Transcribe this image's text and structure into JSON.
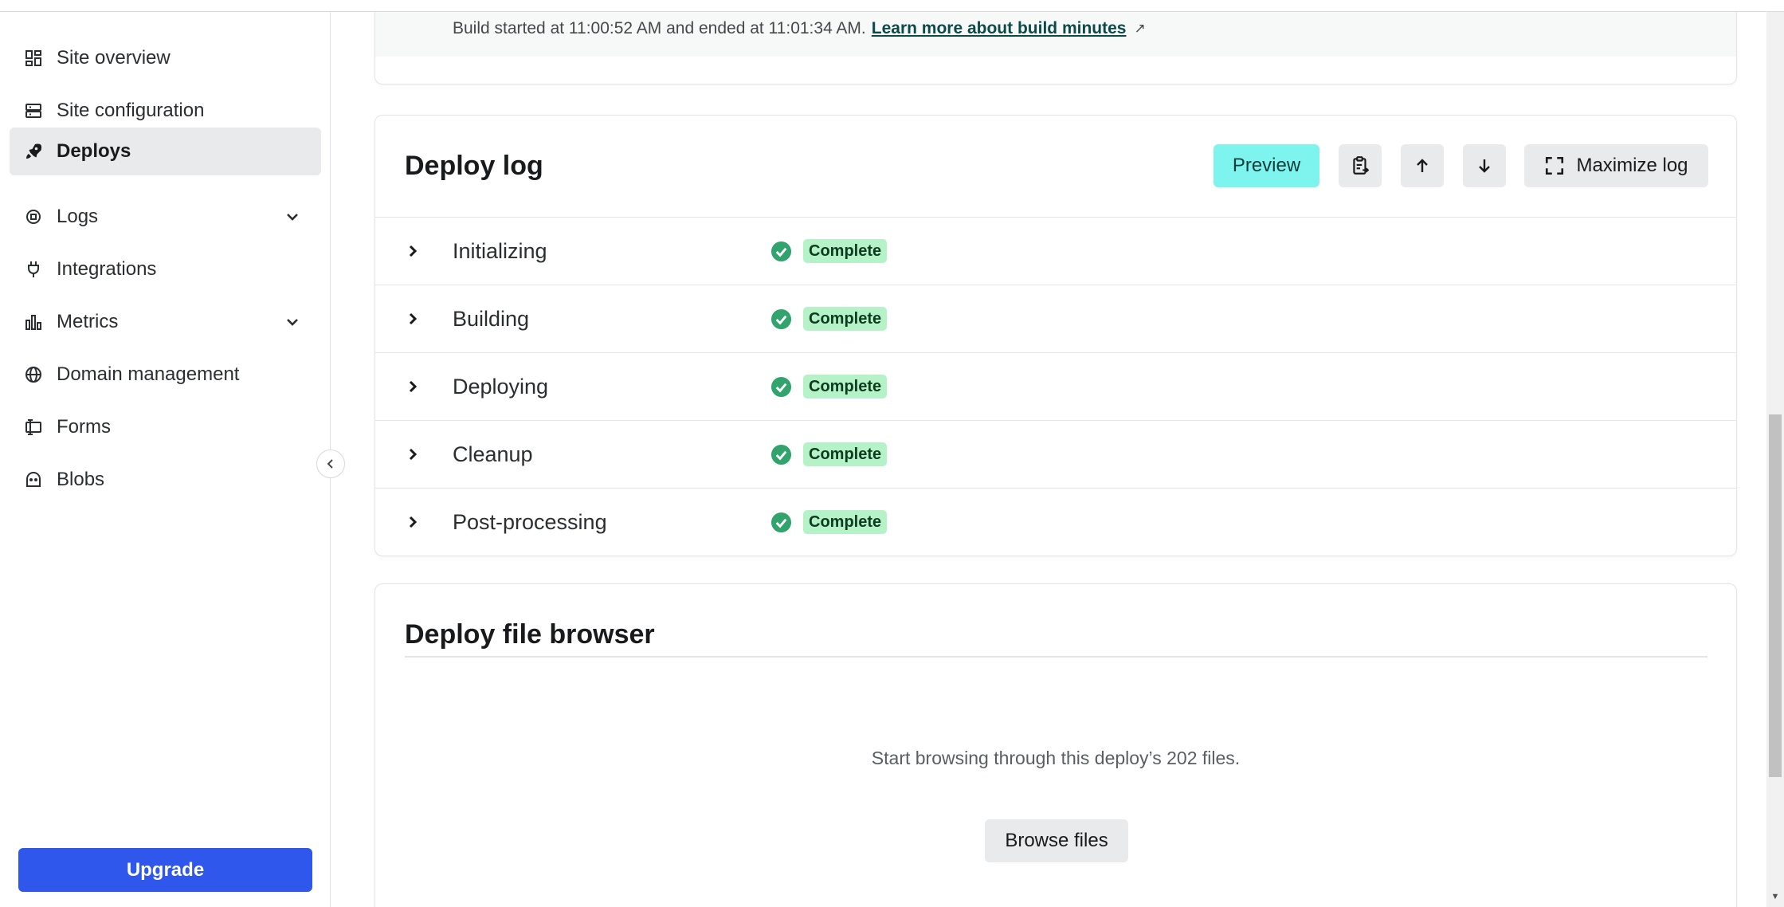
{
  "sidebar": {
    "items": [
      {
        "label": "Site overview",
        "icon": "grid-icon"
      },
      {
        "label": "Site configuration",
        "icon": "config-icon"
      },
      {
        "label": "Deploys",
        "icon": "rocket-icon",
        "active": true
      },
      {
        "label": "Logs",
        "icon": "logs-icon",
        "expandable": true
      },
      {
        "label": "Integrations",
        "icon": "plug-icon"
      },
      {
        "label": "Metrics",
        "icon": "bar-chart-icon",
        "expandable": true
      },
      {
        "label": "Domain management",
        "icon": "globe-icon"
      },
      {
        "label": "Forms",
        "icon": "forms-icon"
      },
      {
        "label": "Blobs",
        "icon": "blobs-icon"
      }
    ],
    "upgrade_label": "Upgrade"
  },
  "build_info": {
    "text": "Build started at 11:00:52 AM and ended at 11:01:34 AM.",
    "link": "Learn more about build minutes"
  },
  "deploy_log": {
    "title": "Deploy log",
    "preview_label": "Preview",
    "maximize_label": "Maximize log",
    "steps": [
      {
        "label": "Initializing",
        "status": "Complete"
      },
      {
        "label": "Building",
        "status": "Complete"
      },
      {
        "label": "Deploying",
        "status": "Complete"
      },
      {
        "label": "Cleanup",
        "status": "Complete"
      },
      {
        "label": "Post-processing",
        "status": "Complete"
      }
    ]
  },
  "file_browser": {
    "title": "Deploy file browser",
    "description": "Start browsing through this deploy’s 202 files.",
    "browse_label": "Browse files"
  },
  "colors": {
    "accent_blue": "#2f57ec",
    "preview_teal": "#7ef4ee",
    "success_green": "#30a46c",
    "badge_green": "#b6f2c8"
  }
}
